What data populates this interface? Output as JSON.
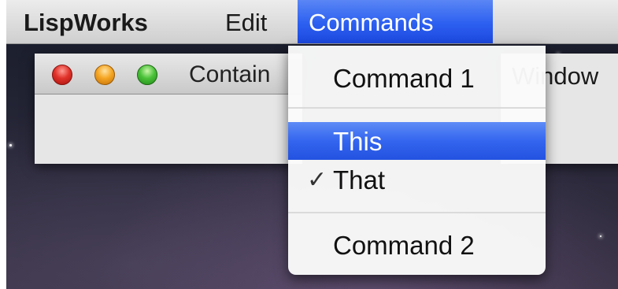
{
  "menubar": {
    "app_name": "LispWorks",
    "edit": "Edit",
    "commands": "Commands",
    "window": "Window"
  },
  "background_window": {
    "title": "Contain"
  },
  "commands_menu": {
    "items": [
      {
        "label": "Command 1",
        "checked": false,
        "selected": false
      },
      {
        "label": "This",
        "checked": false,
        "selected": true
      },
      {
        "label": "That",
        "checked": true,
        "selected": false
      },
      {
        "label": "Command 2",
        "checked": false,
        "selected": false
      }
    ],
    "checkmark": "✓"
  },
  "colors": {
    "highlight": "#2c5ff0",
    "menubar": "#dcdcdc",
    "desktop": "#262637"
  }
}
